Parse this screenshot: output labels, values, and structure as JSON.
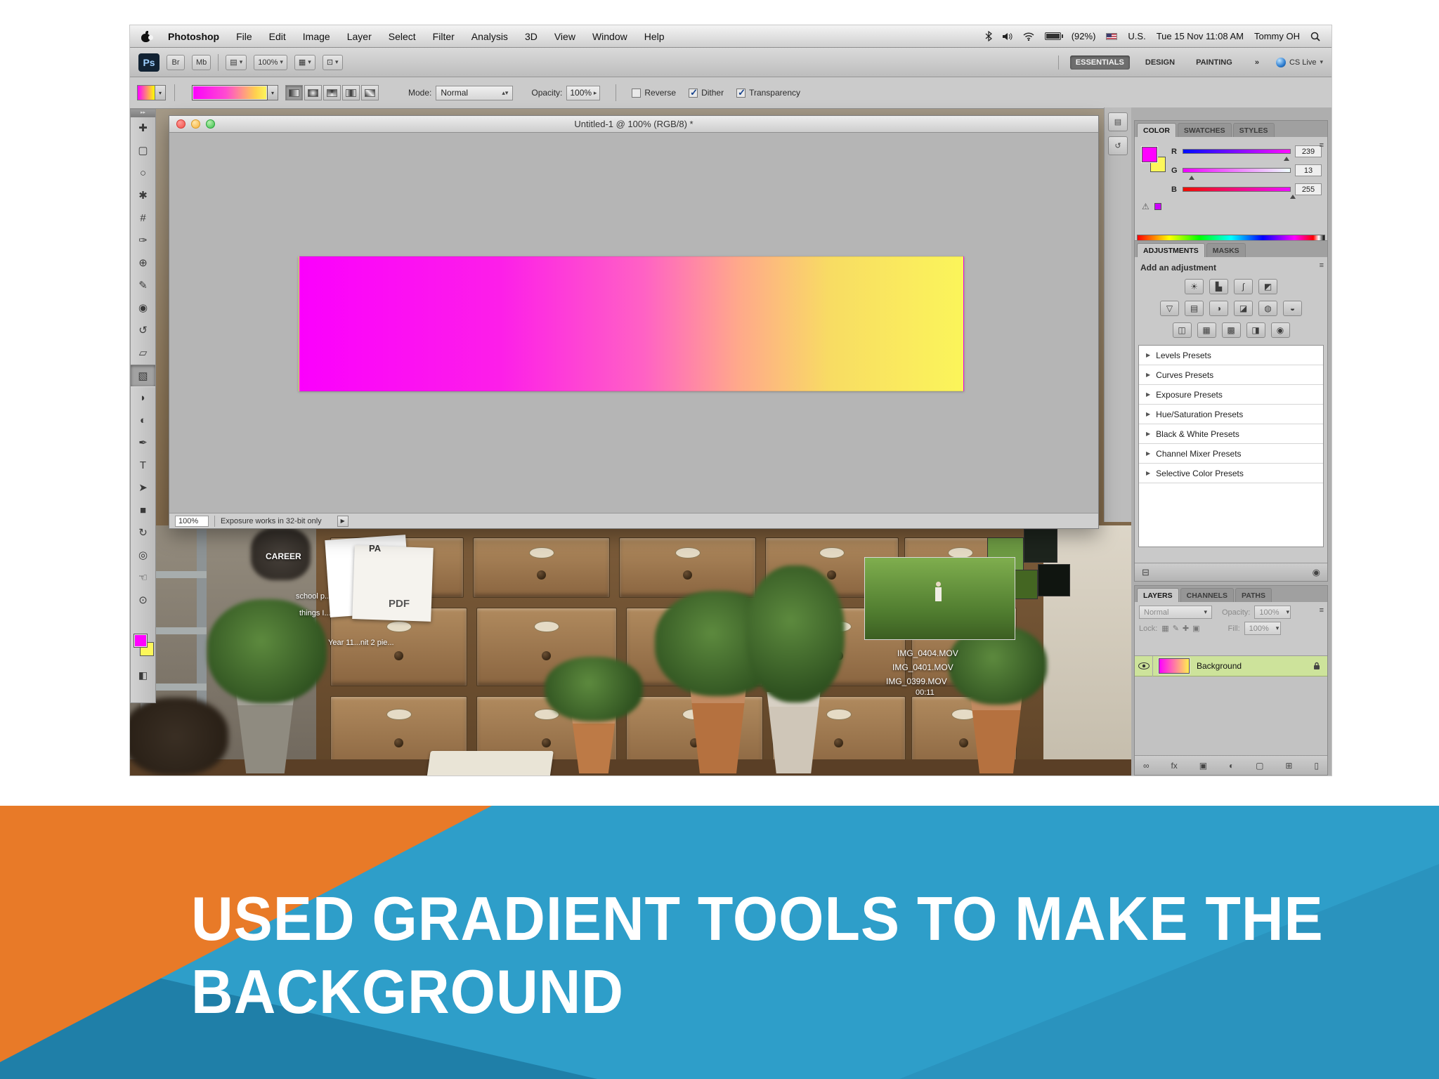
{
  "slide": {
    "title": [
      "USED GRADIENT TOOLS TO MAKE THE",
      "BACKGROUND"
    ]
  },
  "menubar": {
    "app_menu": "Photoshop",
    "menus": [
      "File",
      "Edit",
      "Image",
      "Layer",
      "Select",
      "Filter",
      "Analysis",
      "3D",
      "View",
      "Window",
      "Help"
    ],
    "battery": "(92%)",
    "input_label": "U.S.",
    "clock": "Tue 15 Nov 11:08 AM",
    "user": "Tommy OH"
  },
  "appbar": {
    "logo": "Ps",
    "bridge": "Br",
    "minibridge": "Mb",
    "zoom": "100%",
    "workspaces": [
      "ESSENTIALS",
      "DESIGN",
      "PAINTING"
    ],
    "workspace_more": "»",
    "cs_live": "CS Live"
  },
  "optionsbar": {
    "mode_label": "Mode:",
    "mode_value": "Normal",
    "opacity_label": "Opacity:",
    "opacity_value": "100%",
    "checkboxes": [
      {
        "label": "Reverse",
        "checked": false
      },
      {
        "label": "Dither",
        "checked": true
      },
      {
        "label": "Transparency",
        "checked": true
      }
    ]
  },
  "tools": [
    {
      "name": "move-tool",
      "glyph": "✚"
    },
    {
      "name": "marquee-tool",
      "glyph": "▢"
    },
    {
      "name": "lasso-tool",
      "glyph": "○"
    },
    {
      "name": "quick-selection-tool",
      "glyph": "✱"
    },
    {
      "name": "crop-tool",
      "glyph": "#"
    },
    {
      "name": "eyedropper-tool",
      "glyph": "✑"
    },
    {
      "name": "healing-brush-tool",
      "glyph": "⊕"
    },
    {
      "name": "brush-tool",
      "glyph": "✎"
    },
    {
      "name": "clone-stamp-tool",
      "glyph": "◉"
    },
    {
      "name": "history-brush-tool",
      "glyph": "↺"
    },
    {
      "name": "eraser-tool",
      "glyph": "▱"
    },
    {
      "name": "gradient-tool",
      "glyph": "▧",
      "selected": true
    },
    {
      "name": "blur-tool",
      "glyph": "◗"
    },
    {
      "name": "dodge-tool",
      "glyph": "◐"
    },
    {
      "name": "pen-tool",
      "glyph": "✒"
    },
    {
      "name": "type-tool",
      "glyph": "T"
    },
    {
      "name": "path-selection-tool",
      "glyph": "➤"
    },
    {
      "name": "shape-tool",
      "glyph": "■"
    },
    {
      "name": "3d-rotate-tool",
      "glyph": "↻"
    },
    {
      "name": "3d-orbit-tool",
      "glyph": "◎"
    },
    {
      "name": "hand-tool",
      "glyph": "☜"
    },
    {
      "name": "zoom-tool",
      "glyph": "⊙"
    }
  ],
  "document": {
    "title": "Untitled-1 @ 100% (RGB/8) *",
    "zoom": "100%",
    "status": "Exposure works in 32-bit only"
  },
  "color_panel": {
    "tabs": [
      "COLOR",
      "SWATCHES",
      "STYLES"
    ],
    "channels": [
      {
        "label": "R",
        "value": "239"
      },
      {
        "label": "G",
        "value": "13"
      },
      {
        "label": "B",
        "value": "255"
      }
    ]
  },
  "adjustments_panel": {
    "tabs": [
      "ADJUSTMENTS",
      "MASKS"
    ],
    "header": "Add an adjustment",
    "icon_rows": [
      [
        "brightness-contrast",
        "levels",
        "curves",
        "exposure"
      ],
      [
        "vibrance",
        "hue-saturation",
        "color-balance",
        "black-white",
        "photo-filter",
        "channel-mixer"
      ],
      [
        "invert",
        "posterize",
        "threshold",
        "gradient-map",
        "selective-color"
      ]
    ],
    "presets": [
      "Levels Presets",
      "Curves Presets",
      "Exposure Presets",
      "Hue/Saturation Presets",
      "Black & White Presets",
      "Channel Mixer Presets",
      "Selective Color Presets"
    ]
  },
  "layers_panel": {
    "tabs": [
      "LAYERS",
      "CHANNELS",
      "PATHS"
    ],
    "blend_mode": "Normal",
    "opacity_label": "Opacity:",
    "opacity_value": "100%",
    "lock_label": "Lock:",
    "fill_label": "Fill:",
    "fill_value": "100%",
    "layer_name": "Background"
  },
  "desktop": {
    "labels": {
      "career": "CAREER",
      "pa": "PA",
      "pdf": "PDF",
      "line1": "school p...to",
      "line2": "things I...",
      "line3": "Year 11...nit 2 pie..."
    },
    "files": [
      "IMG_0404.MOV",
      "IMG_0401.MOV",
      "IMG_0399.MOV"
    ],
    "video_time": "00:11"
  }
}
